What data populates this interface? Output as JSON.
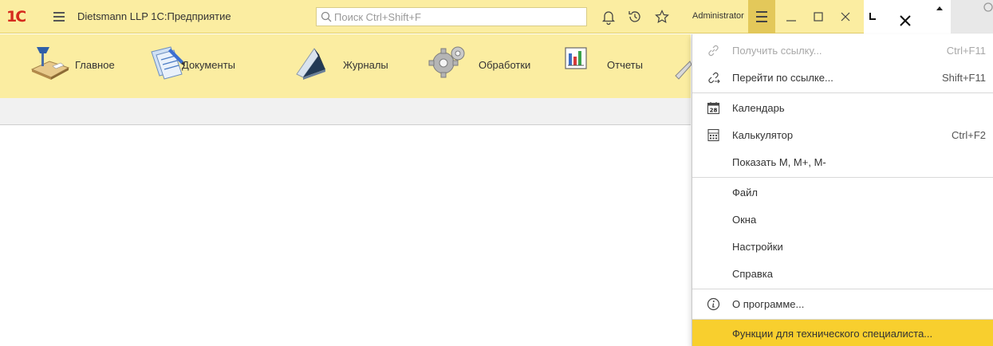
{
  "titlebar": {
    "logo": "1С",
    "app_title": "Dietsmann LLP  1С:Предприятие",
    "search_placeholder": "Поиск Ctrl+Shift+F",
    "user": "Administrator"
  },
  "sections": [
    {
      "label": "Главное",
      "icon": "desk-lamp-icon"
    },
    {
      "label": "Документы",
      "icon": "documents-icon"
    },
    {
      "label": "Журналы",
      "icon": "journals-icon"
    },
    {
      "label": "Обработки",
      "icon": "gear-icon"
    },
    {
      "label": "Отчеты",
      "icon": "report-chart-icon"
    }
  ],
  "menu": {
    "items": [
      {
        "label": "Получить ссылку...",
        "shortcut": "Ctrl+F11",
        "icon": "link-icon",
        "disabled": true
      },
      {
        "label": "Перейти по ссылке...",
        "shortcut": "Shift+F11",
        "icon": "link-go-icon",
        "disabled": false
      },
      {
        "label": "Календарь",
        "shortcut": "",
        "icon": "calendar-icon",
        "disabled": false,
        "icon_text": "28"
      },
      {
        "label": "Калькулятор",
        "shortcut": "Ctrl+F2",
        "icon": "calculator-icon",
        "disabled": false
      },
      {
        "label": "Показать М, М+, М-",
        "shortcut": "",
        "icon": "",
        "disabled": false
      },
      {
        "label": "Файл",
        "shortcut": "",
        "icon": "",
        "disabled": false
      },
      {
        "label": "Окна",
        "shortcut": "",
        "icon": "",
        "disabled": false
      },
      {
        "label": "Настройки",
        "shortcut": "",
        "icon": "",
        "disabled": false
      },
      {
        "label": "Справка",
        "shortcut": "",
        "icon": "",
        "disabled": false
      },
      {
        "label": "О программе...",
        "shortcut": "",
        "icon": "info-icon",
        "disabled": false
      },
      {
        "label": "Функции для технического специалиста...",
        "shortcut": "",
        "icon": "",
        "disabled": false,
        "highlighted": true
      }
    ]
  },
  "colors": {
    "titlebar_bg": "#fbeda1",
    "menu_highlight": "#f8cf2e",
    "logo_red": "#d52b1e"
  }
}
